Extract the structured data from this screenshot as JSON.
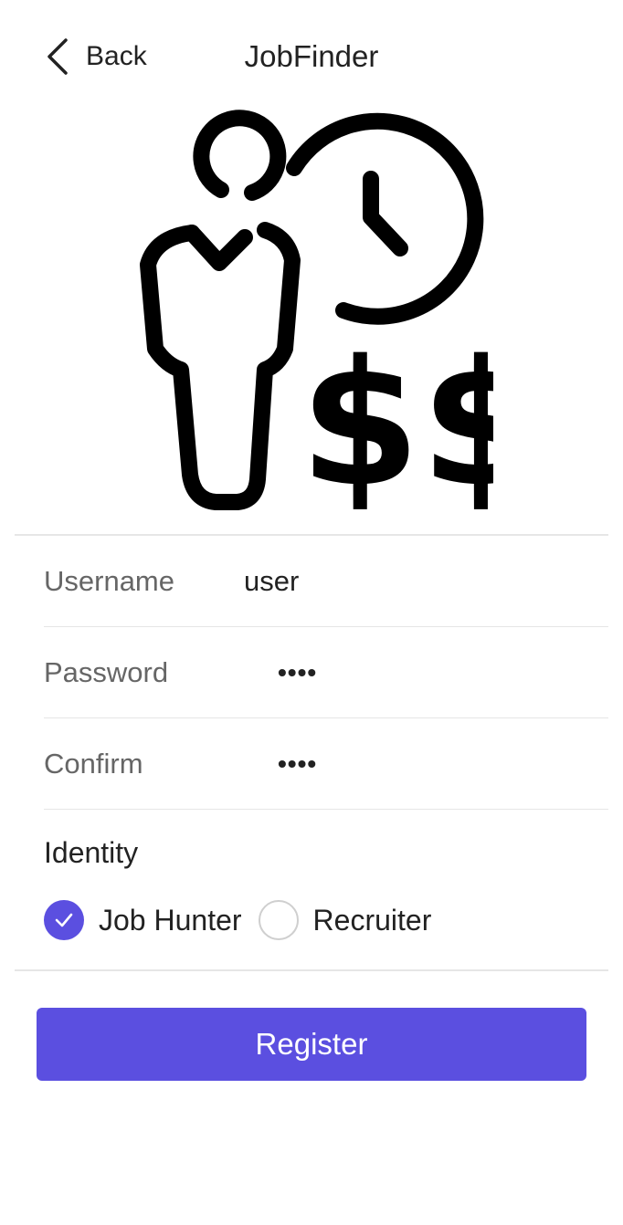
{
  "header": {
    "back_label": "Back",
    "title": "JobFinder"
  },
  "hero": {
    "icon": "job-hunter-clock-money-illustration"
  },
  "form": {
    "username": {
      "label": "Username",
      "value": "user"
    },
    "password": {
      "label": "Password",
      "value": "••••"
    },
    "confirm": {
      "label": "Confirm",
      "value": "••••"
    }
  },
  "identity": {
    "label": "Identity",
    "options": [
      {
        "label": "Job Hunter",
        "selected": true
      },
      {
        "label": "Recruiter",
        "selected": false
      }
    ]
  },
  "actions": {
    "register_label": "Register"
  },
  "colors": {
    "accent": "#5b4fe0",
    "divider": "#e6e6e6",
    "label_gray": "#666666",
    "text": "#222222"
  }
}
